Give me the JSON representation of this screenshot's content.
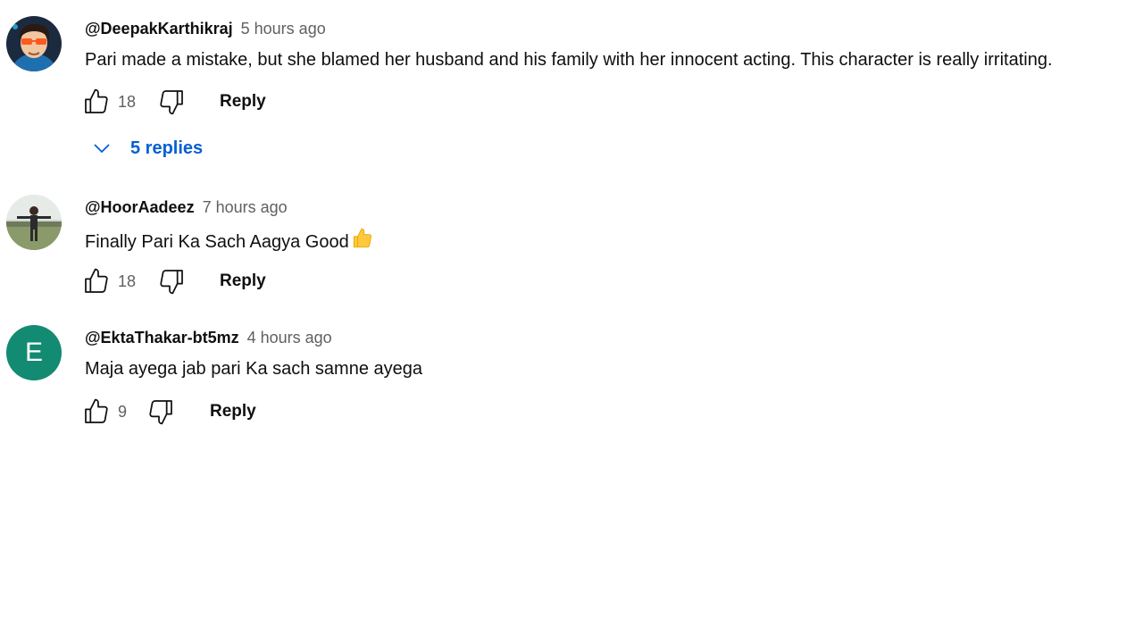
{
  "comments": [
    {
      "author": "@DeepakKarthikraj",
      "time": "5 hours ago",
      "text": "Pari made a mistake, but she blamed her husband and his family with her innocent acting. This character is really irritating.",
      "likes": "18",
      "reply_label": "Reply",
      "replies_label": "5 replies",
      "avatar": "cartoon-boy-avatar"
    },
    {
      "author": "@HoorAadeez",
      "time": "7 hours ago",
      "text": "Finally Pari Ka Sach Aagya Good",
      "emoji": "thumbs-up-emoji",
      "likes": "18",
      "reply_label": "Reply",
      "avatar": "photo-avatar"
    },
    {
      "author": "@EktaThakar-bt5mz",
      "time": "4 hours ago",
      "text": "Maja ayega jab pari Ka sach samne ayega",
      "likes": "9",
      "reply_label": "Reply",
      "avatar_letter": "E",
      "avatar_color": "#138a72"
    }
  ],
  "colors": {
    "link_blue": "#065fd4",
    "meta_gray": "#606060",
    "text_dark": "#0f0f0f"
  },
  "icons": [
    "thumbs-up-icon",
    "thumbs-down-icon",
    "chevron-down-icon"
  ]
}
